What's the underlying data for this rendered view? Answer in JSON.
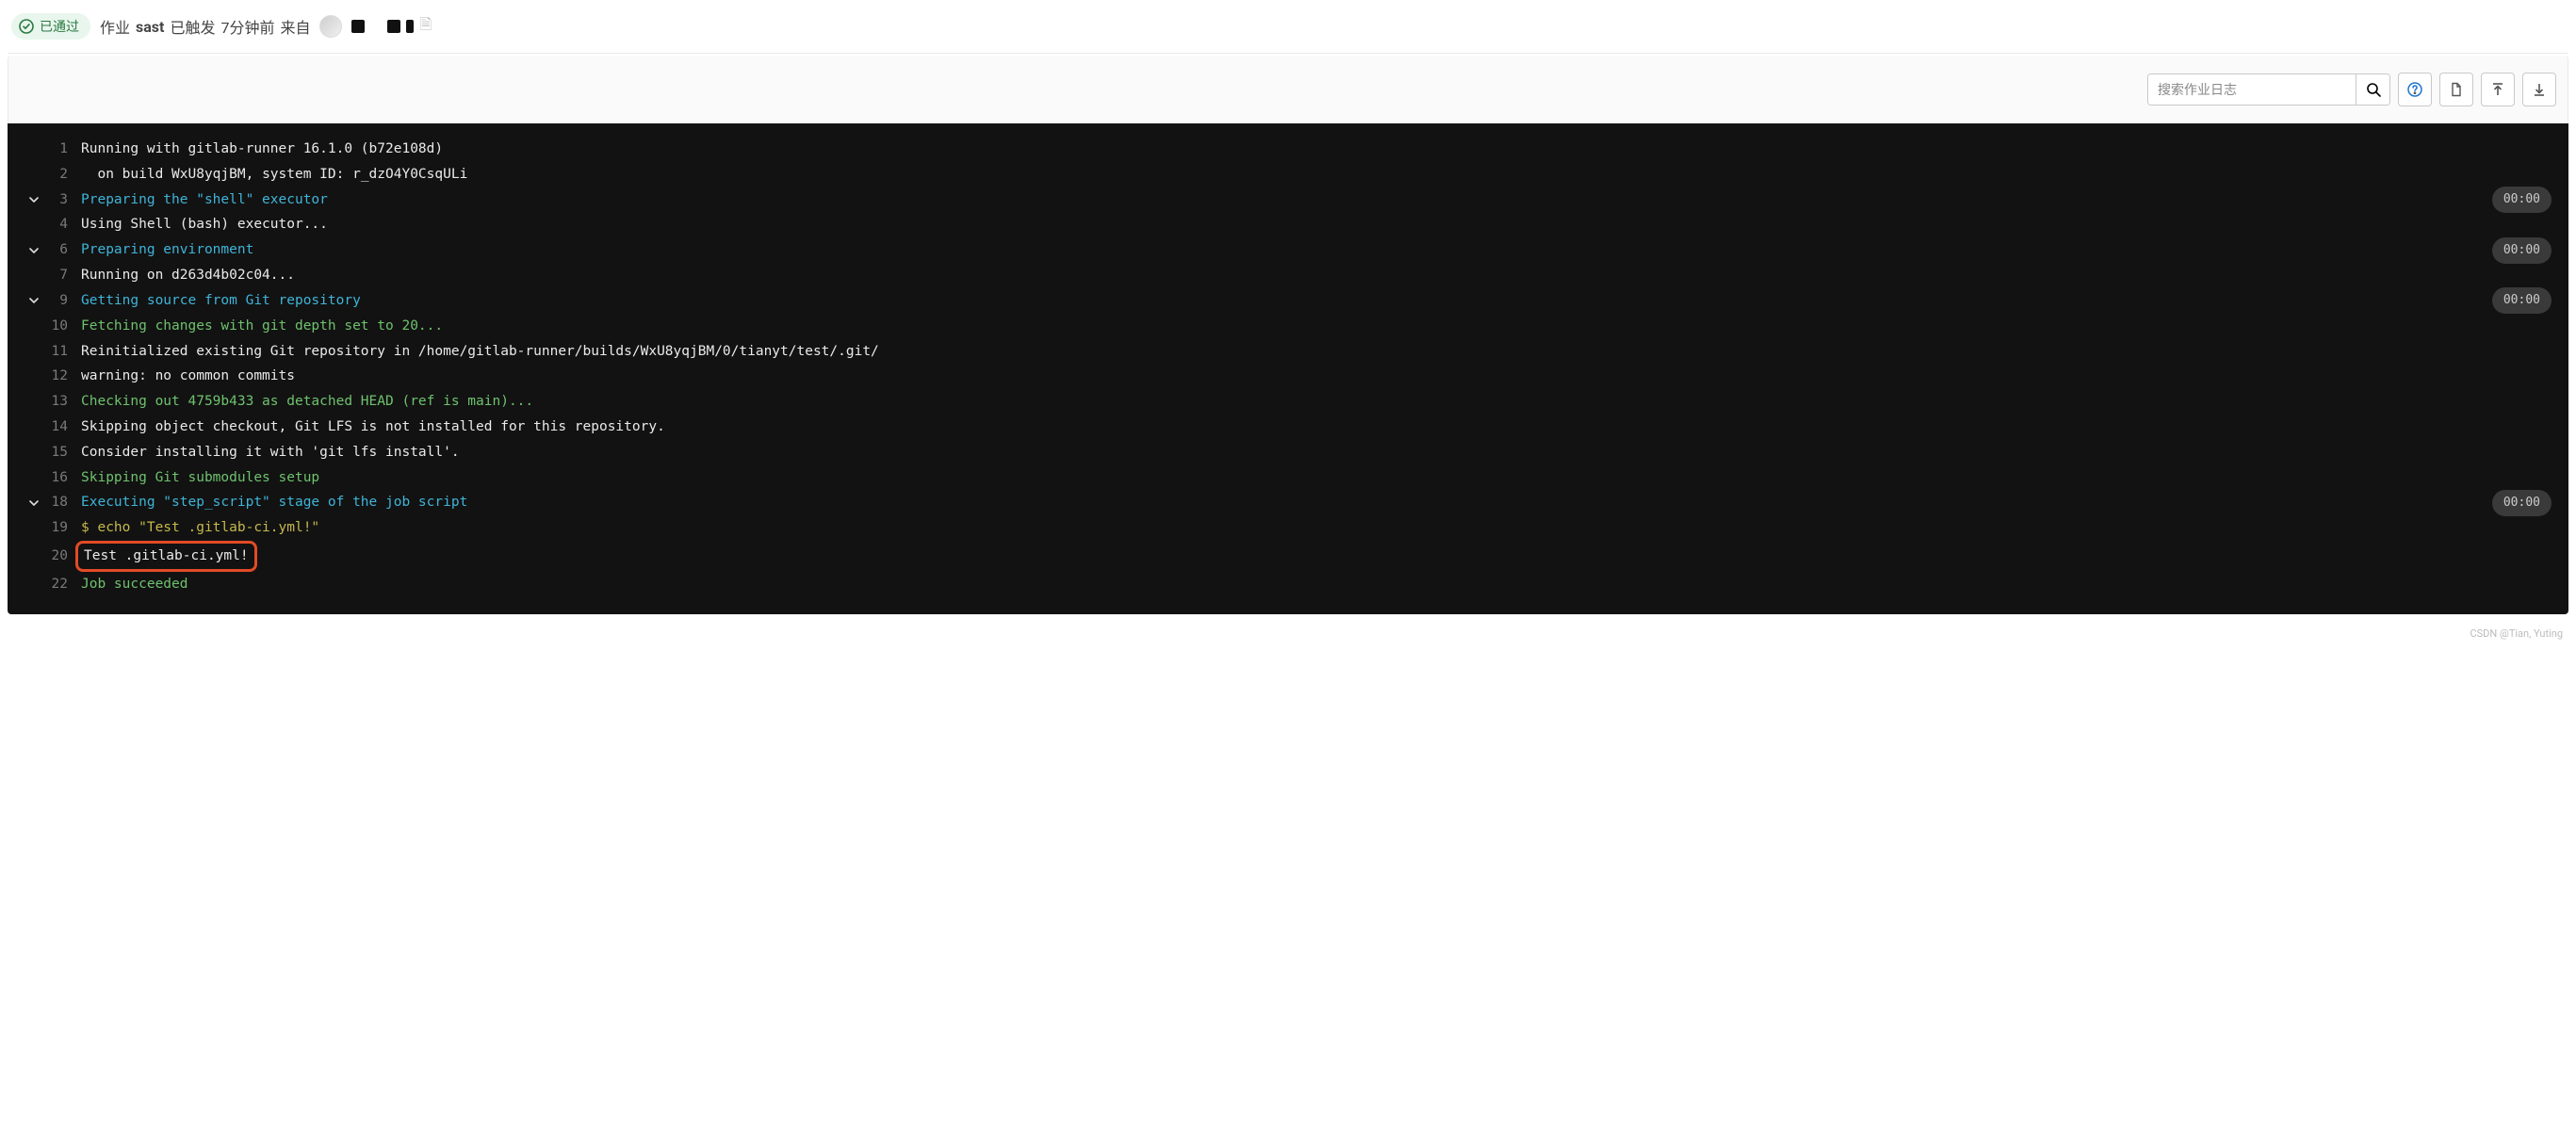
{
  "header": {
    "status_label": "已通过",
    "job_prefix": "作业",
    "job_name": "sast",
    "triggered_text": "已触发",
    "time_ago": "7分钟前",
    "from_text": "来自"
  },
  "toolbar": {
    "search_placeholder": "搜索作业日志",
    "help_label": "help",
    "raw_label": "raw-log",
    "top_label": "scroll-top",
    "bottom_label": "scroll-bottom"
  },
  "log_lines": [
    {
      "n": 1,
      "text": "Running with gitlab-runner 16.1.0 (b72e108d)",
      "cls": "txt-white"
    },
    {
      "n": 2,
      "text": "  on build WxU8yqjBM, system ID: r_dzO4Y0CsqULi",
      "cls": "txt-white"
    },
    {
      "n": 3,
      "text": "Preparing the \"shell\" executor",
      "cls": "txt-cyan",
      "section": true,
      "duration": "00:00"
    },
    {
      "n": 4,
      "text": "Using Shell (bash) executor...",
      "cls": "txt-white"
    },
    {
      "n": 6,
      "text": "Preparing environment",
      "cls": "txt-cyan",
      "section": true,
      "duration": "00:00"
    },
    {
      "n": 7,
      "text": "Running on d263d4b02c04...",
      "cls": "txt-white"
    },
    {
      "n": 9,
      "text": "Getting source from Git repository",
      "cls": "txt-cyan",
      "section": true,
      "duration": "00:00"
    },
    {
      "n": 10,
      "text": "Fetching changes with git depth set to 20...",
      "cls": "txt-green"
    },
    {
      "n": 11,
      "text": "Reinitialized existing Git repository in /home/gitlab-runner/builds/WxU8yqjBM/0/tianyt/test/.git/",
      "cls": "txt-white"
    },
    {
      "n": 12,
      "text": "warning: no common commits",
      "cls": "txt-white"
    },
    {
      "n": 13,
      "text": "Checking out 4759b433 as detached HEAD (ref is main)...",
      "cls": "txt-green"
    },
    {
      "n": 14,
      "text": "Skipping object checkout, Git LFS is not installed for this repository.",
      "cls": "txt-white"
    },
    {
      "n": 15,
      "text": "Consider installing it with 'git lfs install'.",
      "cls": "txt-white"
    },
    {
      "n": 16,
      "text": "Skipping Git submodules setup",
      "cls": "txt-green"
    },
    {
      "n": 18,
      "text": "Executing \"step_script\" stage of the job script",
      "cls": "txt-cyan",
      "section": true,
      "duration": "00:00"
    },
    {
      "n": 19,
      "text": "$ echo \"Test .gitlab-ci.yml!\"",
      "cls": "txt-yellow"
    },
    {
      "n": 20,
      "text": "Test .gitlab-ci.yml!",
      "cls": "txt-white",
      "boxed": true
    },
    {
      "n": 22,
      "text": "Job succeeded",
      "cls": "txt-green"
    }
  ],
  "watermark": "CSDN @Tian, Yuting"
}
